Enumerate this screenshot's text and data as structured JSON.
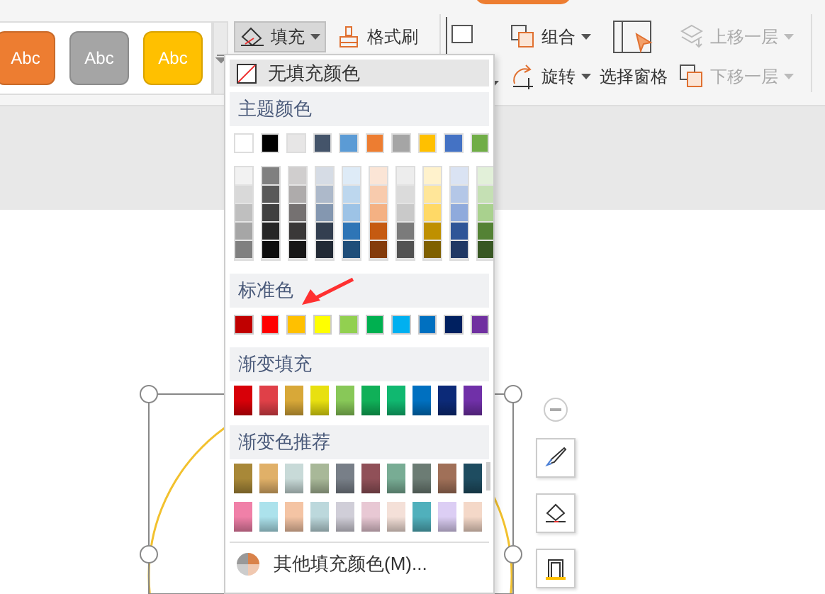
{
  "ribbon": {
    "style_swatches": [
      {
        "label": "Abc",
        "color": "#ed7d31"
      },
      {
        "label": "Abc",
        "color": "#a5a5a5"
      },
      {
        "label": "Abc",
        "color": "#ffc000"
      }
    ],
    "fill_button": {
      "label": "填充",
      "pressed": true
    },
    "format_painter": {
      "label": "格式刷"
    },
    "tool_columns": [
      [
        {
          "label": "组合",
          "disabled": false
        },
        {
          "label": "旋转",
          "disabled": false
        }
      ],
      [
        {
          "label": "选择窗格",
          "disabled": false
        }
      ],
      [
        {
          "label": "上移一层",
          "disabled": true
        },
        {
          "label": "下移一层",
          "disabled": true
        }
      ]
    ]
  },
  "fill_menu": {
    "no_fill": {
      "label": "无填充颜色"
    },
    "sections": [
      {
        "kind": "theme",
        "title": "主题颜色",
        "base": [
          {
            "color": "#ffffff"
          },
          {
            "color": "#000000"
          },
          {
            "color": "#e7e6e6"
          },
          {
            "color": "#44546a"
          },
          {
            "color": "#5b9bd5"
          },
          {
            "color": "#ed7d31"
          },
          {
            "color": "#a5a5a5"
          },
          {
            "color": "#ffc000"
          },
          {
            "color": "#4472c4"
          },
          {
            "color": "#70ad47"
          }
        ],
        "shades": [
          [
            {
              "color": "#f2f2f2"
            },
            {
              "color": "#d9d9d9"
            },
            {
              "color": "#bfbfbf"
            },
            {
              "color": "#a6a6a6"
            },
            {
              "color": "#808080"
            }
          ],
          [
            {
              "color": "#808080"
            },
            {
              "color": "#595959"
            },
            {
              "color": "#404040"
            },
            {
              "color": "#262626"
            },
            {
              "color": "#0d0d0d"
            }
          ],
          [
            {
              "color": "#d0cece"
            },
            {
              "color": "#aeabab"
            },
            {
              "color": "#757171"
            },
            {
              "color": "#3a3838"
            },
            {
              "color": "#171616"
            }
          ],
          [
            {
              "color": "#d6dce5"
            },
            {
              "color": "#adb9ca"
            },
            {
              "color": "#8497b0"
            },
            {
              "color": "#333f50"
            },
            {
              "color": "#222a35"
            }
          ],
          [
            {
              "color": "#deebf7"
            },
            {
              "color": "#bdd7ee"
            },
            {
              "color": "#9dc3e6"
            },
            {
              "color": "#2e75b6"
            },
            {
              "color": "#1f4e79"
            }
          ],
          [
            {
              "color": "#fbe5d6"
            },
            {
              "color": "#f8cbad"
            },
            {
              "color": "#f4b183"
            },
            {
              "color": "#c55a11"
            },
            {
              "color": "#843c0c"
            }
          ],
          [
            {
              "color": "#ededed"
            },
            {
              "color": "#dbdbdb"
            },
            {
              "color": "#c9c9c9"
            },
            {
              "color": "#7b7b7b"
            },
            {
              "color": "#525252"
            }
          ],
          [
            {
              "color": "#fff2cc"
            },
            {
              "color": "#ffe699"
            },
            {
              "color": "#ffd966"
            },
            {
              "color": "#bf9000"
            },
            {
              "color": "#7f6000"
            }
          ],
          [
            {
              "color": "#dae3f3"
            },
            {
              "color": "#b4c7e7"
            },
            {
              "color": "#8faadc"
            },
            {
              "color": "#2f5597"
            },
            {
              "color": "#203864"
            }
          ],
          [
            {
              "color": "#e2f0d9"
            },
            {
              "color": "#c5e0b4"
            },
            {
              "color": "#a9d18e"
            },
            {
              "color": "#548235"
            },
            {
              "color": "#385723"
            }
          ]
        ]
      },
      {
        "kind": "standard",
        "title": "标准色",
        "colors": [
          {
            "color": "#c00000"
          },
          {
            "color": "#ff0000"
          },
          {
            "color": "#ffc000"
          },
          {
            "color": "#ffff00"
          },
          {
            "color": "#92d050"
          },
          {
            "color": "#00b050"
          },
          {
            "color": "#00b0f0"
          },
          {
            "color": "#0070c0"
          },
          {
            "color": "#002060"
          },
          {
            "color": "#7030a0"
          }
        ]
      },
      {
        "kind": "gradient",
        "title": "渐变填充",
        "rows": [
          [
            {
              "color": "#d80008"
            },
            {
              "color": "#e04048"
            },
            {
              "color": "#d8a838"
            },
            {
              "color": "#e8e010"
            },
            {
              "color": "#88c858"
            },
            {
              "color": "#10b058"
            },
            {
              "color": "#10b870"
            },
            {
              "color": "#0070c0"
            },
            {
              "color": "#0c2a78"
            },
            {
              "color": "#7030a8"
            }
          ]
        ]
      },
      {
        "kind": "gradient",
        "title": "渐变色推荐",
        "rows": [
          [
            {
              "color": "#a88838"
            },
            {
              "color": "#e0b068"
            },
            {
              "color": "#c8dad8"
            },
            {
              "color": "#a8b898"
            },
            {
              "color": "#787f88"
            },
            {
              "color": "#905058"
            },
            {
              "color": "#78ac94"
            },
            {
              "color": "#6c7c74"
            },
            {
              "color": "#a07058"
            },
            {
              "color": "#1e4c60"
            }
          ],
          [
            {
              "color": "#f080a8"
            },
            {
              "color": "#ace2ec"
            },
            {
              "color": "#f4c4a4"
            },
            {
              "color": "#bcd8dc"
            },
            {
              "color": "#d0ced8"
            },
            {
              "color": "#e8c8d4"
            },
            {
              "color": "#f4e0d8"
            },
            {
              "color": "#50b0bc"
            },
            {
              "color": "#dccef4"
            },
            {
              "color": "#f4d8c8"
            }
          ]
        ]
      }
    ],
    "more": {
      "label": "其他填充颜色(M)..."
    }
  }
}
